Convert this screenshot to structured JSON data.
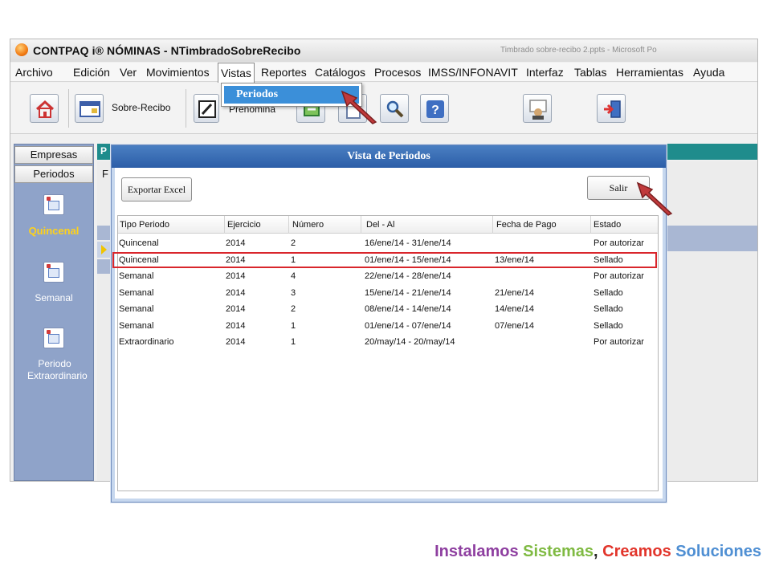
{
  "window": {
    "title": "CONTPAQ i® NÓMINAS - NTimbradoSobreRecibo",
    "title_bar_faint_text": "Timbrado sobre-recibo 2.ppts - Microsoft Po"
  },
  "menu": {
    "items": [
      "Archivo",
      "Edición",
      "Ver",
      "Movimientos",
      "Vistas",
      "Reportes",
      "Catálogos",
      "Procesos",
      "IMSS/INFONAVIT",
      "Interfaz",
      "Tablas",
      "Herramientas",
      "Ayuda"
    ],
    "open_menu": "Vistas",
    "dropdown_items": [
      "Periodos"
    ]
  },
  "toolbar": {
    "sobre_recibo_label": "Sobre-Recibo",
    "prenomina_label": "Prenómina",
    "icons": [
      "home-icon",
      "sobre-recibo-icon",
      "prenomina-icon",
      "export-icon",
      "document-icon",
      "search-tools-icon",
      "help-icon",
      "user-card-icon",
      "exit-door-icon"
    ]
  },
  "left_nav": {
    "tabs": [
      "Empresas",
      "Periodos"
    ],
    "items": [
      {
        "label": "Quincenal",
        "active": true
      },
      {
        "label": "Semanal",
        "active": false
      },
      {
        "label": "Periodo Extraordinario",
        "active": false
      }
    ]
  },
  "dialog": {
    "title": "Vista de Periodos",
    "export_button": "Exportar Excel",
    "exit_button": "Salir",
    "columns": [
      "Tipo Periodo",
      "Ejercicio",
      "Número",
      "Del - Al",
      "Fecha de Pago",
      "Estado"
    ],
    "rows": [
      [
        "Quincenal",
        "2014",
        "2",
        "16/ene/14 - 31/ene/14",
        "",
        "Por autorizar"
      ],
      [
        "Quincenal",
        "2014",
        "1",
        "01/ene/14 - 15/ene/14",
        "13/ene/14",
        "Sellado"
      ],
      [
        "Semanal",
        "2014",
        "4",
        "22/ene/14 - 28/ene/14",
        "",
        "Por autorizar"
      ],
      [
        "Semanal",
        "2014",
        "3",
        "15/ene/14 - 21/ene/14",
        "21/ene/14",
        "Sellado"
      ],
      [
        "Semanal",
        "2014",
        "2",
        "08/ene/14 - 14/ene/14",
        "14/ene/14",
        "Sellado"
      ],
      [
        "Semanal",
        "2014",
        "1",
        "01/ene/14 - 07/ene/14",
        "07/ene/14",
        "Sellado"
      ],
      [
        "Extraordinario",
        "2014",
        "1",
        "20/may/14 - 20/may/14",
        "",
        "Por autorizar"
      ]
    ],
    "highlighted_row": 1
  },
  "background_labels": {
    "teal_bar_letter": "P",
    "panel_letter": "F"
  },
  "slogan": {
    "part1": "Instalamos",
    "part2": "Sistemas",
    "part3": ",",
    "part4": "Creamos",
    "part5": "Soluciones",
    "colors": {
      "part1": "#8e3fa0",
      "part2": "#7fba42",
      "part3": "#222222",
      "part4": "#e2352b",
      "part5": "#4f8fd3"
    }
  },
  "colors": {
    "accent_blue": "#3b8fd9",
    "dialog_title": "#2c5ea8",
    "teal": "#1f8c8c",
    "nav_blue": "#8fa3c9",
    "highlight_red": "#d9262c",
    "active_nav_yellow": "#ffd21a"
  }
}
